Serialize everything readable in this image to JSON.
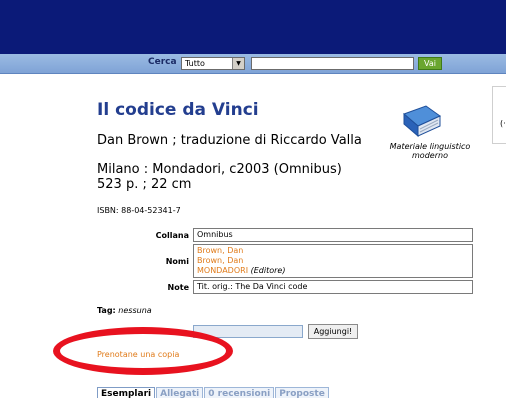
{
  "search": {
    "label": "Cerca",
    "scope_value": "Tutto",
    "input_value": "",
    "go_label": "Vai"
  },
  "record": {
    "title": "Il codice da Vinci",
    "author": "Dan Brown ; traduzione di Riccardo Valla",
    "publication": "Milano : Mondadori, c2003 (Omnibus)",
    "extent": "523 p. ; 22 cm",
    "isbn": "ISBN: 88-04-52341-7",
    "material_type": "Materiale linguistico moderno",
    "side_glyph": "(·"
  },
  "fields": {
    "collana_label": "Collana",
    "collana_value": "Omnibus",
    "nomi_label": "Nomi",
    "nomi_1": "Brown, Dan",
    "nomi_2": "Brown, Dan",
    "nomi_3": "MONDADORI",
    "nomi_3_role": "(Editore)",
    "note_label": "Note",
    "note_value": "Tit. orig.: The Da Vinci code"
  },
  "tags": {
    "label": "Tag:",
    "value": "nessuna",
    "hidden_label": "",
    "add_label": "Aggiungi!"
  },
  "actions": {
    "reserve_label": "Prenotane una copia",
    "reserve_label_2": ""
  },
  "tabs": [
    {
      "label": "Esemplari"
    },
    {
      "label": "Allegati"
    },
    {
      "label": "0 recensioni"
    },
    {
      "label": "Proposte"
    }
  ],
  "colors": {
    "topbar": "#0b1a78",
    "title": "#233e8f",
    "link": "#e07b1a",
    "highlight": "#e8121f",
    "go_button": "#6aa62f"
  },
  "icons": {
    "material": "blue-book-icon"
  }
}
